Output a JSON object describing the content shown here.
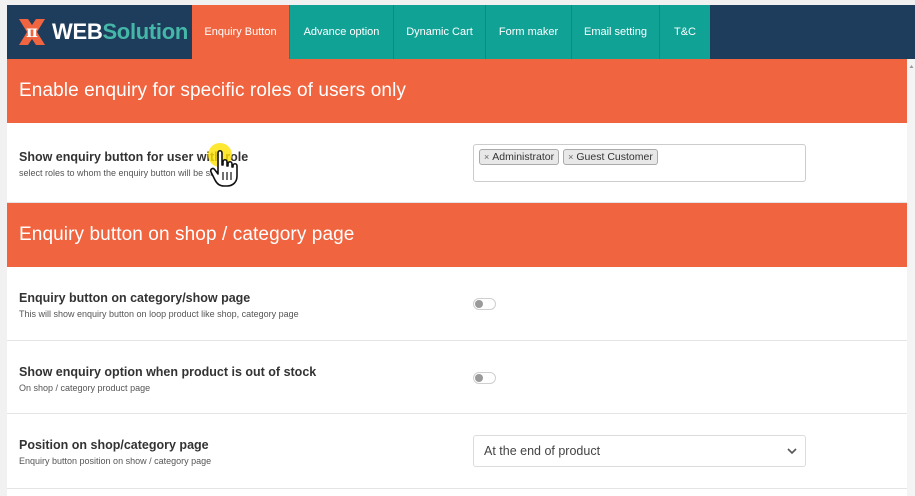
{
  "brand": {
    "logo_part1": "WEB",
    "logo_part2": "Solution"
  },
  "tabs": [
    {
      "label": "Enquiry Button",
      "active": true
    },
    {
      "label": "Advance option",
      "active": false
    },
    {
      "label": "Dynamic Cart",
      "active": false
    },
    {
      "label": "Form maker",
      "active": false
    },
    {
      "label": "Email setting",
      "active": false
    },
    {
      "label": "T&C",
      "active": false
    }
  ],
  "sections": {
    "roles": {
      "title": "Enable enquiry for specific roles of users only",
      "setting": {
        "label": "Show enquiry button for user with role",
        "description": "select roles to whom the enquiry button will be shown",
        "selected_roles": [
          "Administrator",
          "Guest Customer"
        ],
        "chip_remove": "×"
      }
    },
    "shop": {
      "title": "Enquiry button on shop / category page",
      "settings": {
        "category_page": {
          "label": "Enquiry button on category/show page",
          "description": "This will show enquiry button on loop product like shop, category page",
          "enabled": false
        },
        "out_of_stock": {
          "label": "Show enquiry option when product is out of stock",
          "description": "On shop / category product page",
          "enabled": false
        },
        "position": {
          "label": "Position on shop/category page",
          "description": "Enquiry button position on show / category page",
          "value": "At the end of product"
        }
      }
    }
  },
  "colors": {
    "header_bg": "#1e3d5c",
    "tab_bg": "#11a296",
    "accent": "#f0643f",
    "logo_accent": "#45b7a8"
  },
  "icons": {
    "logo": "pi-x-logo-icon",
    "cursor": "hand-pointer-icon",
    "select_caret": "chevron-down-icon"
  }
}
